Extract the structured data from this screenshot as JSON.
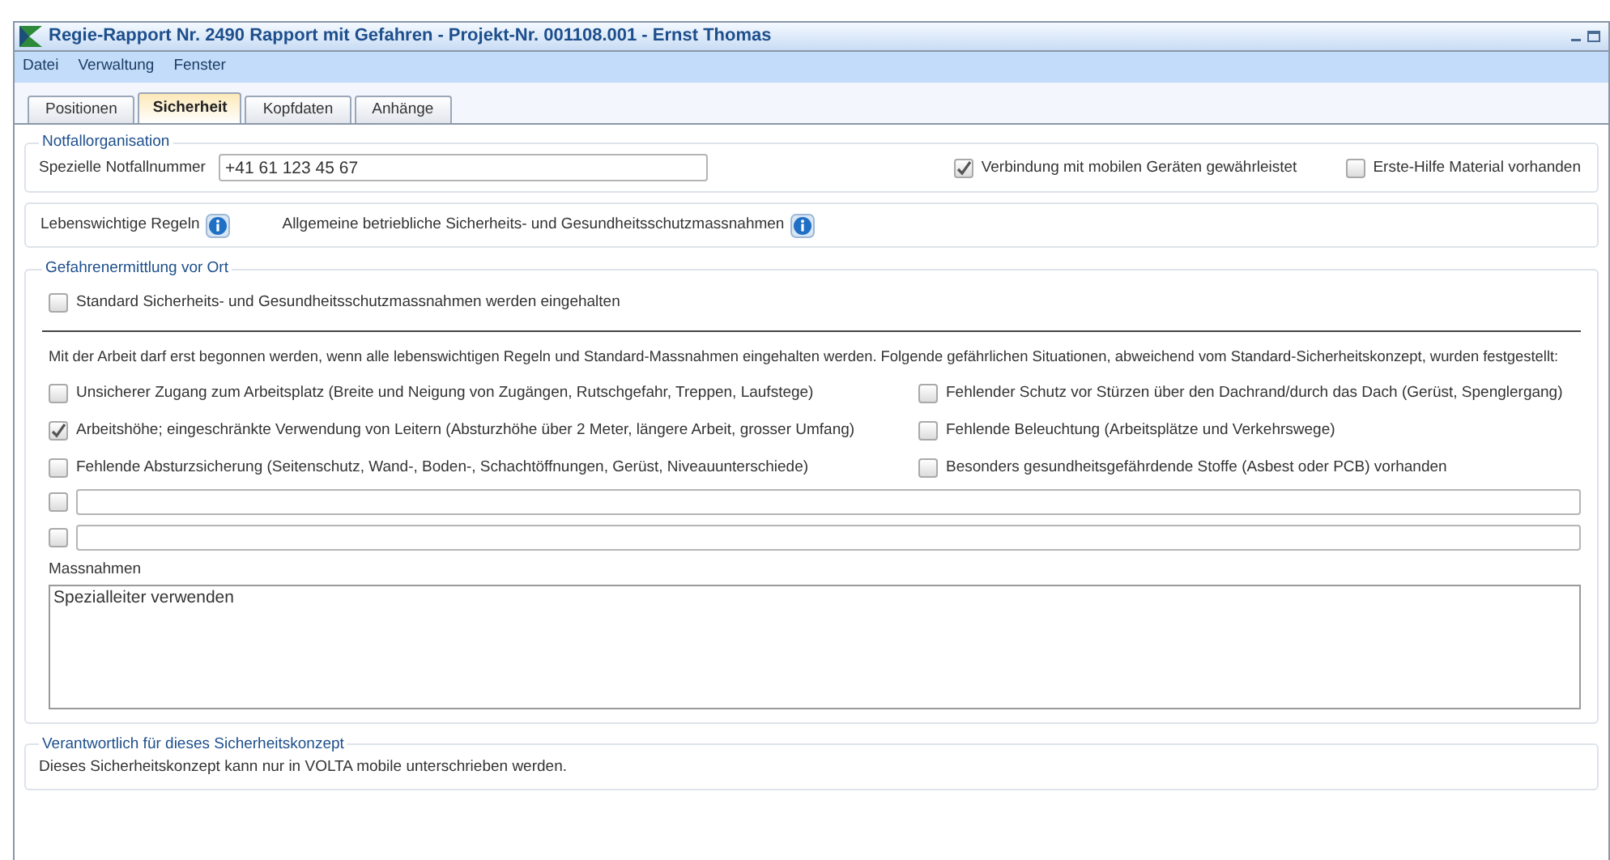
{
  "window": {
    "title": "Regie-Rapport Nr. 2490 Rapport mit Gefahren - Projekt-Nr. 001108.001 - Ernst Thomas"
  },
  "menu": [
    "Datei",
    "Verwaltung",
    "Fenster"
  ],
  "tabs": [
    {
      "label": "Positionen",
      "selected": false
    },
    {
      "label": "Sicherheit",
      "selected": true
    },
    {
      "label": "Kopfdaten",
      "selected": false
    },
    {
      "label": "Anhänge",
      "selected": false
    }
  ],
  "notfall": {
    "legend": "Notfallorganisation",
    "label": "Spezielle Notfallnummer",
    "value": "+41 61 123 45 67",
    "checks": [
      {
        "label": "Verbindung mit mobilen Geräten gewährleistet",
        "checked": true
      },
      {
        "label": "Erste-Hilfe Material vorhanden",
        "checked": false
      }
    ]
  },
  "rules": [
    "Lebenswichtige Regeln",
    "Allgemeine betriebliche Sicherheits- und Gesundheitsschutzmassnahmen"
  ],
  "gefahren": {
    "legend": "Gefahrenermittlung vor Ort",
    "standard": {
      "label": "Standard Sicherheits- und Gesundheitsschutzmassnahmen werden eingehalten",
      "checked": false
    },
    "intro": "Mit der Arbeit darf erst begonnen werden, wenn alle lebenswichtigen Regeln und Standard-Massnahmen eingehalten werden. Folgende gefährlichen Situationen, abweichend vom Standard-Sicherheitskonzept, wurden festgestellt:",
    "hazards": [
      {
        "label": "Unsicherer Zugang zum Arbeitsplatz (Breite und Neigung von Zugängen, Rutschgefahr, Treppen, Laufstege)",
        "checked": false
      },
      {
        "label": "Fehlender Schutz vor Stürzen über den Dachrand/durch das Dach (Gerüst, Spenglergang)",
        "checked": false
      },
      {
        "label": "Arbeitshöhe; eingeschränkte Verwendung von Leitern (Absturzhöhe über 2 Meter, längere Arbeit, grosser Umfang)",
        "checked": true
      },
      {
        "label": "Fehlende Beleuchtung (Arbeitsplätze und Verkehrswege)",
        "checked": false
      },
      {
        "label": "Fehlende Absturzsicherung (Seitenschutz, Wand-, Boden-, Schachtöffnungen, Gerüst, Niveauunterschiede)",
        "checked": false
      },
      {
        "label": "Besonders gesundheitsgefährdende Stoffe (Asbest oder PCB) vorhanden",
        "checked": false
      }
    ],
    "custom": [
      {
        "checked": false
      },
      {
        "checked": false
      }
    ],
    "massnahmen_label": "Massnahmen",
    "massnahmen_value": "Spezialleiter verwenden"
  },
  "verantwortlich": {
    "legend": "Verantwortlich für dieses Sicherheitskonzept",
    "text": "Dieses Sicherheitskonzept kann nur in VOLTA mobile unterschrieben werden."
  }
}
